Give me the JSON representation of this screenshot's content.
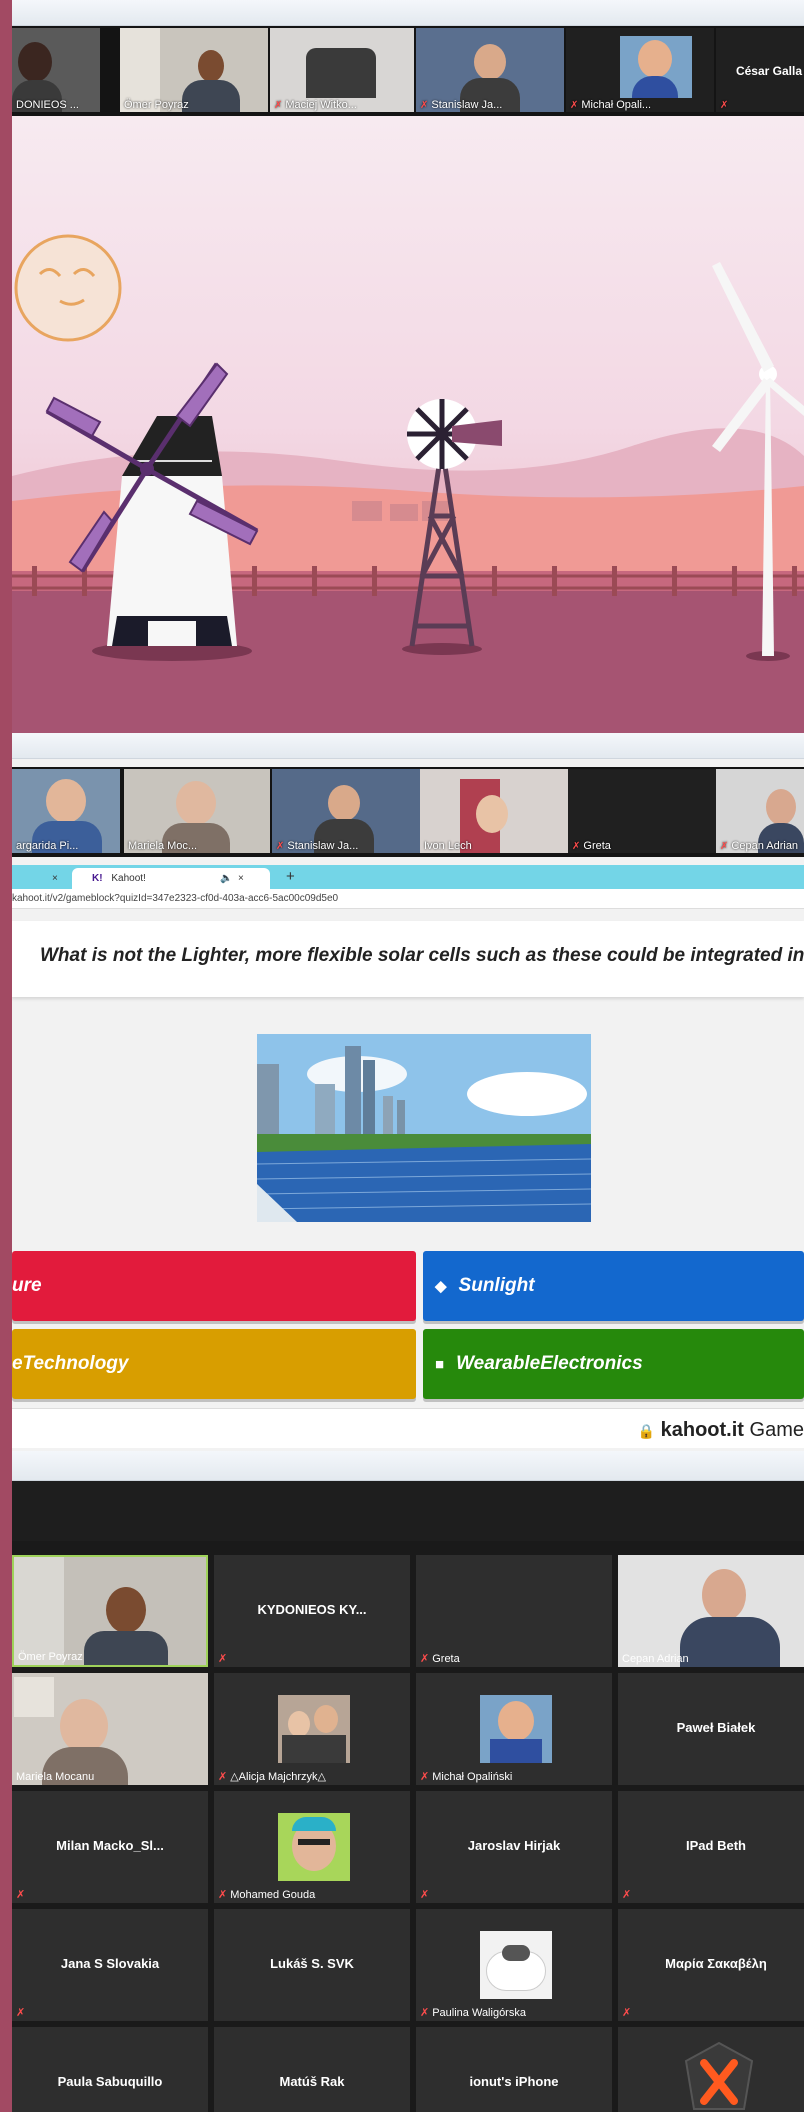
{
  "shot1": {
    "participants": [
      {
        "label": "DONIEOS ...",
        "mic_off": false
      },
      {
        "label": "Ömer Poyraz",
        "mic_off": false
      },
      {
        "label": "Maciej Witko...",
        "mic_off": true
      },
      {
        "label": "Stanislaw Ja...",
        "mic_off": true
      },
      {
        "label": "Michał Opali...",
        "mic_off": true
      },
      {
        "label": "César Galla",
        "mic_off": true
      }
    ]
  },
  "shot2": {
    "participants": [
      {
        "label": "argarida Pi...",
        "mic_off": false
      },
      {
        "label": "Mariela Moc...",
        "mic_off": false
      },
      {
        "label": "Stanislaw Ja...",
        "mic_off": true
      },
      {
        "label": "Ivon Lech",
        "mic_off": false
      },
      {
        "label": "Greta",
        "mic_off": true
      },
      {
        "label": "Cepan Adrian",
        "mic_off": true
      }
    ],
    "browser": {
      "tab_close_left": "×",
      "tab_title": "Kahoot!",
      "tab_sound_icon": "🔈",
      "tab_close": "×",
      "new_tab": "+",
      "url": "kahoot.it/v2/gameblock?quizId=347e2323-cf0d-403a-acc6-5ac00c09d5e0"
    },
    "question": "What is not the Lighter, more flexible solar cells such as these could be integrated into?",
    "answers": [
      {
        "text": "ure",
        "shape": "",
        "color": "#e21b3c"
      },
      {
        "text": "Sunlight",
        "shape": "◆",
        "color": "#1368ce"
      },
      {
        "text": "eTechnology",
        "shape": "",
        "color": "#d89e00"
      },
      {
        "text": "WearableElectronics",
        "shape": "■",
        "color": "#26890c"
      }
    ],
    "footer": {
      "lock_icon": "🔒",
      "brand": "kahoot.it",
      "suffix": "Game"
    }
  },
  "shot3": {
    "tiles": [
      {
        "name": "",
        "label": "Ömer Poyraz",
        "mic_off": false,
        "video": true
      },
      {
        "name": "KYDONIEOS  KY...",
        "label": "",
        "mic_off": true,
        "video": false
      },
      {
        "name": "",
        "label": "Greta",
        "mic_off": true,
        "video": false
      },
      {
        "name": "",
        "label": "Cepan Adrian",
        "mic_off": false,
        "video": true
      },
      {
        "name": "",
        "label": "Mariela Mocanu",
        "mic_off": false,
        "video": true
      },
      {
        "name": "",
        "label": "△Alicja Majchrzyk△",
        "mic_off": true,
        "video": true
      },
      {
        "name": "",
        "label": "Michał Opaliński",
        "mic_off": true,
        "video": true
      },
      {
        "name": "Paweł Białek",
        "label": "",
        "mic_off": false,
        "video": false
      },
      {
        "name": "Milan  Macko_Sl...",
        "label": "",
        "mic_off": true,
        "video": false
      },
      {
        "name": "",
        "label": "Mohamed Gouda",
        "mic_off": true,
        "video": true
      },
      {
        "name": "Jaroslav Hirjak",
        "label": "",
        "mic_off": true,
        "video": false
      },
      {
        "name": "IPad Beth",
        "label": "",
        "mic_off": true,
        "video": false
      },
      {
        "name": "Jana S Slovakia",
        "label": "",
        "mic_off": true,
        "video": false
      },
      {
        "name": "Lukáš S. SVK",
        "label": "",
        "mic_off": false,
        "video": false
      },
      {
        "name": "",
        "label": "Paulina Waligórska",
        "mic_off": true,
        "video": true
      },
      {
        "name": "Μαρία Σακαβέλη",
        "label": "",
        "mic_off": true,
        "video": false
      },
      {
        "name": "Paula Sabuquillo",
        "label": "",
        "mic_off": false,
        "video": false
      },
      {
        "name": "Matúš Rak",
        "label": "",
        "mic_off": false,
        "video": false
      },
      {
        "name": "ionut's iPhone",
        "label": "",
        "mic_off": false,
        "video": false
      },
      {
        "name": "",
        "label": "",
        "mic_off": false,
        "video": true
      }
    ]
  },
  "colors": {
    "border": "#a24a63",
    "kahoot_red": "#e21b3c",
    "kahoot_blue": "#1368ce",
    "kahoot_yellow": "#d89e00",
    "kahoot_green": "#26890c",
    "active_speaker": "#9fd25a"
  },
  "icons": {
    "mic_off": "✗"
  }
}
